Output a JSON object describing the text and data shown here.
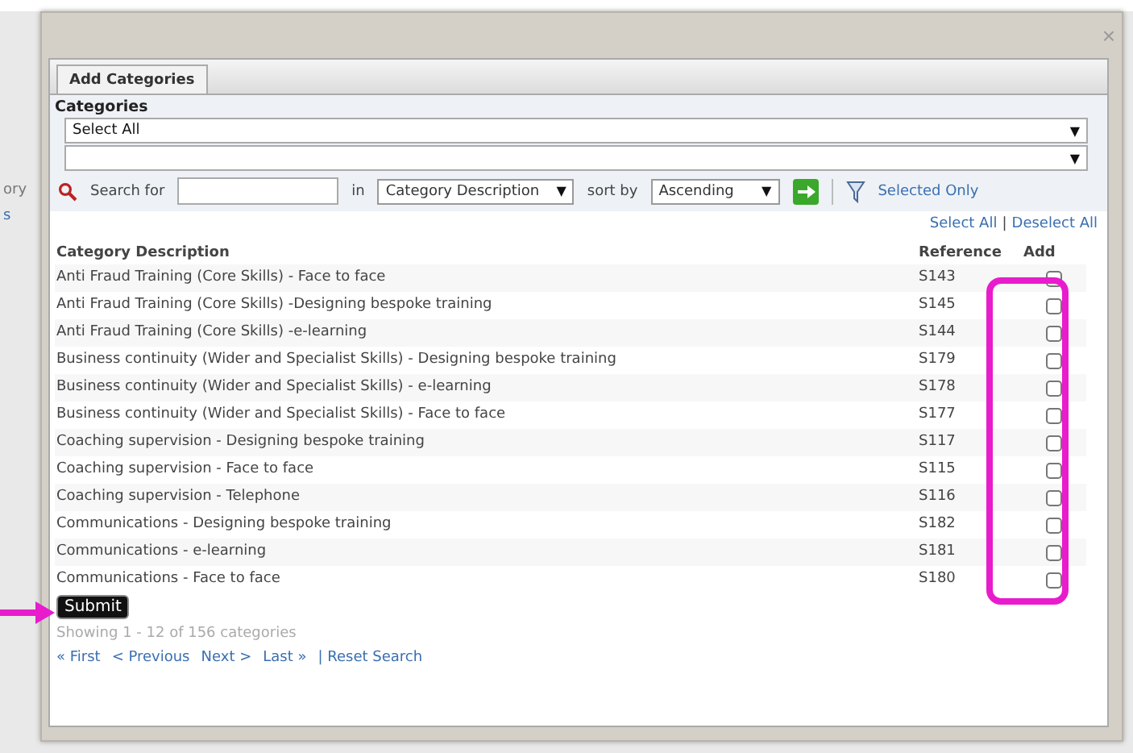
{
  "background": {
    "fragments": [
      {
        "text": "ory",
        "kind": "plain"
      },
      {
        "text": "s",
        "kind": "link"
      }
    ]
  },
  "dialog": {
    "close": "×",
    "tabs": [
      {
        "label": "Add Categories",
        "selected": true
      }
    ],
    "section_title": "Categories",
    "dropdowns": [
      {
        "value": "Select All",
        "arrow": "▼"
      },
      {
        "arrow": "▼"
      }
    ],
    "search": {
      "label": "Search for",
      "in_label": "in",
      "field": {
        "value": "Category Description",
        "arrow": "▼"
      },
      "sort_label": "sort by",
      "sort": {
        "value": "Ascending",
        "arrow": "▼"
      },
      "filter_link": "Selected Only"
    },
    "select_all": "Select All",
    "separator": "|",
    "deselect_all": "Deselect All",
    "table": {
      "columns": [
        "Category Description",
        "Reference",
        "Add"
      ],
      "rows": [
        {
          "description": "Anti Fraud Training (Core Skills) - Face to face",
          "reference": "S143",
          "checked": false
        },
        {
          "description": "Anti Fraud Training (Core Skills) -Designing bespoke training",
          "reference": "S145",
          "checked": false
        },
        {
          "description": "Anti Fraud Training (Core Skills) -e-learning",
          "reference": "S144",
          "checked": false
        },
        {
          "description": "Business continuity (Wider and Specialist Skills) - Designing bespoke training",
          "reference": "S179",
          "checked": false
        },
        {
          "description": "Business continuity (Wider and Specialist Skills) - e-learning",
          "reference": "S178",
          "checked": false
        },
        {
          "description": "Business continuity (Wider and Specialist Skills) - Face to face",
          "reference": "S177",
          "checked": false
        },
        {
          "description": "Coaching supervision - Designing bespoke training",
          "reference": "S117",
          "checked": false
        },
        {
          "description": "Coaching supervision - Face to face",
          "reference": "S115",
          "checked": false
        },
        {
          "description": "Coaching supervision - Telephone",
          "reference": "S116",
          "checked": false
        },
        {
          "description": "Communications - Designing bespoke training",
          "reference": "S182",
          "checked": false
        },
        {
          "description": "Communications - e-learning",
          "reference": "S181",
          "checked": false
        },
        {
          "description": "Communications - Face to face",
          "reference": "S180",
          "checked": false
        }
      ]
    },
    "submit": "Submit",
    "showing": "Showing 1 - 12 of 156 categories",
    "pager": [
      {
        "label": "« First"
      },
      {
        "label": "< Previous"
      },
      {
        "label": "Next >"
      },
      {
        "label": "Last »"
      },
      {
        "label": "| Reset Search"
      }
    ]
  },
  "highlight_box": {
    "color": "#e81ccc"
  },
  "pointer_arrow": {
    "color": "#e81ccc"
  }
}
